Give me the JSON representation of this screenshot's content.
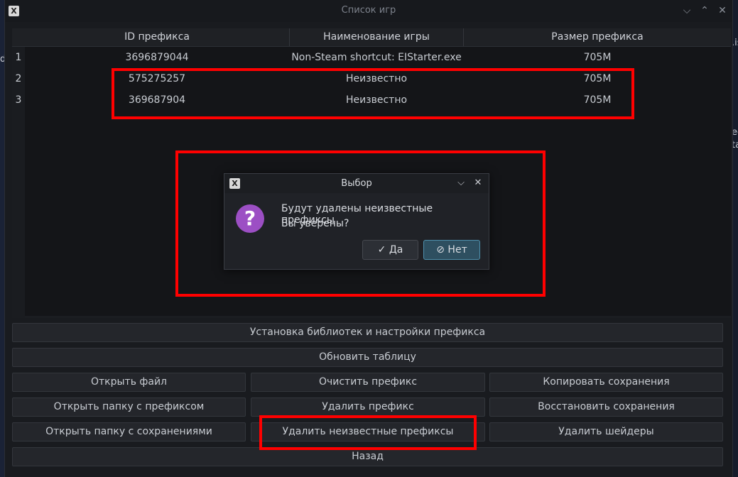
{
  "window": {
    "title": "Список игр"
  },
  "background_fragments": {
    "left": "d",
    "right_1": ".is",
    "right_2": "ec",
    "right_3": "ta"
  },
  "table": {
    "columns": [
      "ID префикса",
      "Наименование игры",
      "Размер префикса"
    ],
    "rows": [
      {
        "num": "1",
        "id": "3696879044",
        "name": "Non-Steam shortcut: EIStarter.exe",
        "size": "705M"
      },
      {
        "num": "2",
        "id": "575275257",
        "name": "Неизвестно",
        "size": "705M"
      },
      {
        "num": "3",
        "id": "369687904",
        "name": "Неизвестно",
        "size": "705M"
      }
    ]
  },
  "dialog": {
    "title": "Выбор",
    "line1": "Будут удалены неизвестные префиксы",
    "line2": "Вы уверены?",
    "yes_label": "✓ Да",
    "no_label": "⊘ Нет"
  },
  "buttons": {
    "install_libs": "Установка библиотек и настройки префикса",
    "refresh": "Обновить таблицу",
    "open_file": "Открыть файл",
    "clean_prefix": "Очистить префикс",
    "copy_saves": "Копировать сохранения",
    "open_prefix_folder": "Открыть папку с префиксом",
    "delete_prefix": "Удалить префикс",
    "restore_saves": "Восстановить сохранения",
    "open_saves_folder": "Открыть папку с сохранениями",
    "delete_unknown": "Удалить неизвестные префиксы",
    "delete_shaders": "Удалить шейдеры",
    "back": "Назад"
  },
  "colors": {
    "highlight": "#ff0000",
    "question_icon": "#9c4fc4",
    "default_button": "#2e4f60"
  }
}
